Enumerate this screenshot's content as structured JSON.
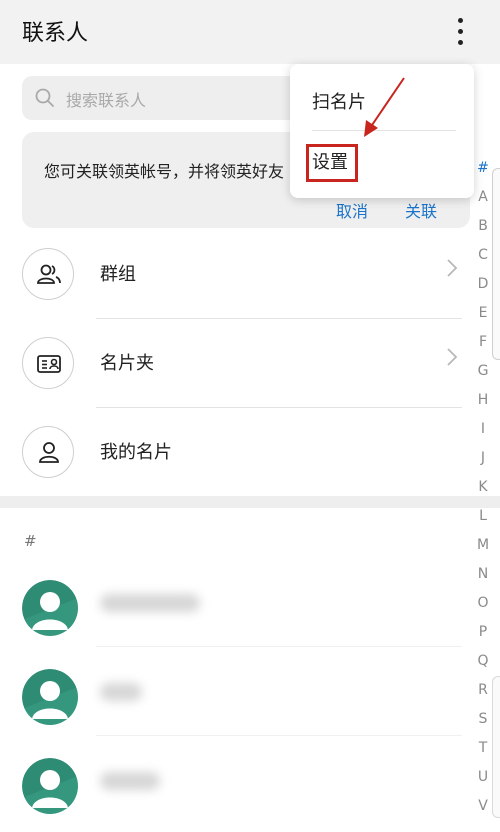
{
  "header": {
    "title": "联系人",
    "more_icon": "more-vertical-icon"
  },
  "search": {
    "placeholder": "搜索联系人",
    "icon": "search-icon"
  },
  "banner": {
    "text": "您可关联领英帐号，并将领英好友",
    "cancel_label": "取消",
    "link_label": "关联"
  },
  "rows": [
    {
      "label": "群组",
      "icon": "group-icon"
    },
    {
      "label": "名片夹",
      "icon": "card-holder-icon"
    },
    {
      "label": "我的名片",
      "icon": "person-icon"
    }
  ],
  "section_header": "#",
  "contacts": [
    {
      "avatar": "default-avatar-icon"
    },
    {
      "avatar": "default-avatar-icon"
    },
    {
      "avatar": "default-avatar-icon"
    }
  ],
  "index_letters": [
    "#",
    "A",
    "B",
    "C",
    "D",
    "E",
    "F",
    "G",
    "H",
    "I",
    "J",
    "K",
    "L",
    "M",
    "N",
    "O",
    "P",
    "Q",
    "R",
    "S",
    "T",
    "U",
    "V"
  ],
  "menu": {
    "items": [
      "扫名片",
      "设置"
    ],
    "highlighted_item": "设置"
  },
  "colors": {
    "accent": "#1b74c9",
    "highlight": "#c8251f",
    "avatar_green": "#2f8c74"
  }
}
